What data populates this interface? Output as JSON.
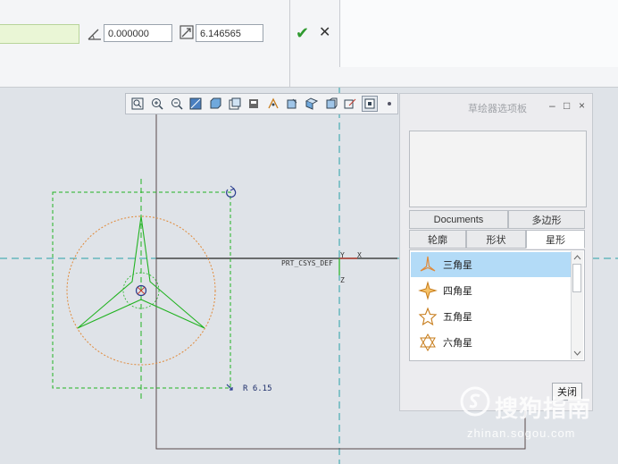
{
  "dashboard": {
    "angle_value": "0.000000",
    "scale_value": "6.146565"
  },
  "sketch": {
    "csys_label": "PRT_CSYS_DEF",
    "axis_y": "Y",
    "axis_x": "X",
    "axis_z": "Z",
    "radius_label": "R 6.15"
  },
  "toolbar": {
    "icons": [
      "refit-icon",
      "zoom-in-icon",
      "zoom-out-icon",
      "repaint-icon",
      "display-style-icon",
      "saved-views-icon",
      "layers-icon",
      "datum-display-icon",
      "annotation-display-icon",
      "appearance-icon",
      "spin-center-icon",
      "sketch-display-icon",
      "sketch-orient-icon",
      "more-icon"
    ]
  },
  "palette": {
    "title": "草绘器选项板",
    "minimize": "–",
    "maximize": "□",
    "close_x": "×",
    "tabs_row1": [
      "Documents",
      "多边形"
    ],
    "tabs_row2": [
      "轮廓",
      "形状",
      "星形"
    ],
    "selected_tab": "星形",
    "items": [
      {
        "label": "三角星",
        "points": 3,
        "selected": true
      },
      {
        "label": "四角星",
        "points": 4,
        "selected": false
      },
      {
        "label": "五角星",
        "points": 5,
        "selected": false
      },
      {
        "label": "六角星",
        "points": 6,
        "selected": false
      }
    ],
    "close_button": "关闭"
  },
  "watermark": {
    "cn": "搜狗指南",
    "en": "zhinan.sogou.com"
  },
  "colors": {
    "sketch_green": "#22b322",
    "construction_orange": "#e08a3a",
    "axis_teal": "#2aa0a8",
    "selection_blue": "#b3dbf7"
  }
}
